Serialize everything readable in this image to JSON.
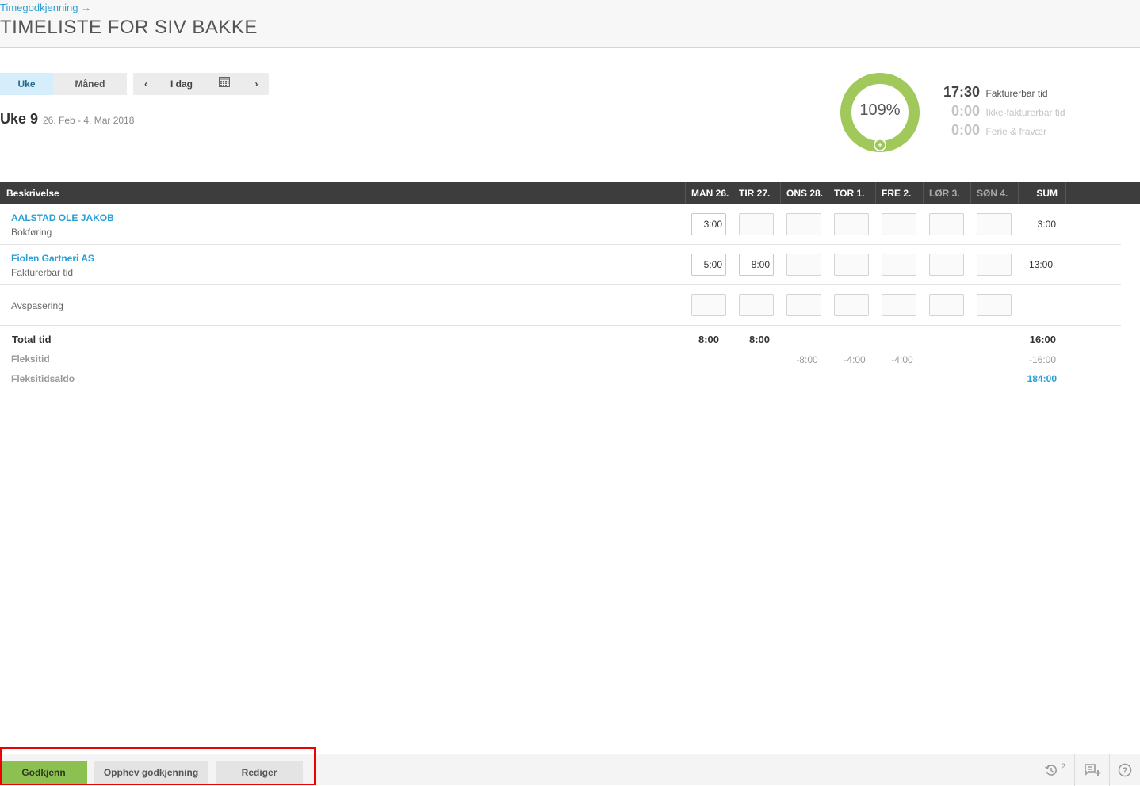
{
  "breadcrumb": {
    "label": "Timegodkjenning →"
  },
  "page": {
    "title": "TIMELISTE FOR SIV BAKKE"
  },
  "period_toggle": {
    "week": "Uke",
    "month": "Måned",
    "active": "week"
  },
  "nav": {
    "prev": "‹",
    "today": "I dag",
    "next": "›"
  },
  "week": {
    "title": "Uke 9",
    "range": "26. Feb - 4. Mar 2018"
  },
  "summary": {
    "percent_label": "109%",
    "percent_value": 109,
    "accent": "#a0c85a",
    "billable": {
      "value": "17:30",
      "label": "Fakturerbar tid"
    },
    "nonbillable": {
      "value": "0:00",
      "label": "Ikke-fakturerbar tid"
    },
    "vacation": {
      "value": "0:00",
      "label": "Ferie & fravær"
    }
  },
  "table": {
    "headers": {
      "description": "Beskrivelse",
      "days": [
        "MAN 26.",
        "TIR 27.",
        "ONS 28.",
        "TOR 1.",
        "FRE 2.",
        "LØR 3.",
        "SØN 4."
      ],
      "sum": "SUM"
    },
    "rows": [
      {
        "name": "AALSTAD OLE JAKOB",
        "sub": "Bokføring",
        "values": [
          "3:00",
          "",
          "",
          "",
          "",
          "",
          ""
        ],
        "sum": "3:00"
      },
      {
        "name": "Fiolen Gartneri AS",
        "sub": "Fakturerbar tid",
        "values": [
          "5:00",
          "8:00",
          "",
          "",
          "",
          "",
          ""
        ],
        "sum": "13:00"
      },
      {
        "name": "",
        "sub": "Avspasering",
        "values": [
          "",
          "",
          "",
          "",
          "",
          "",
          ""
        ],
        "sum": ""
      }
    ],
    "total": {
      "label": "Total tid",
      "values": [
        "8:00",
        "8:00",
        "",
        "",
        "",
        "",
        ""
      ],
      "sum": "16:00"
    },
    "flex": {
      "label": "Fleksitid",
      "values": [
        "",
        "",
        "-8:00",
        "-4:00",
        "-4:00",
        "",
        ""
      ],
      "sum": "-16:00"
    },
    "flex_balance": {
      "label": "Fleksitidsaldo",
      "sum": "184:00"
    }
  },
  "footer": {
    "approve": "Godkjenn",
    "unapprove": "Opphev godkjenning",
    "edit": "Rediger",
    "history_count": "2",
    "icons": [
      "history-icon",
      "add-comment-icon",
      "help-icon"
    ]
  }
}
